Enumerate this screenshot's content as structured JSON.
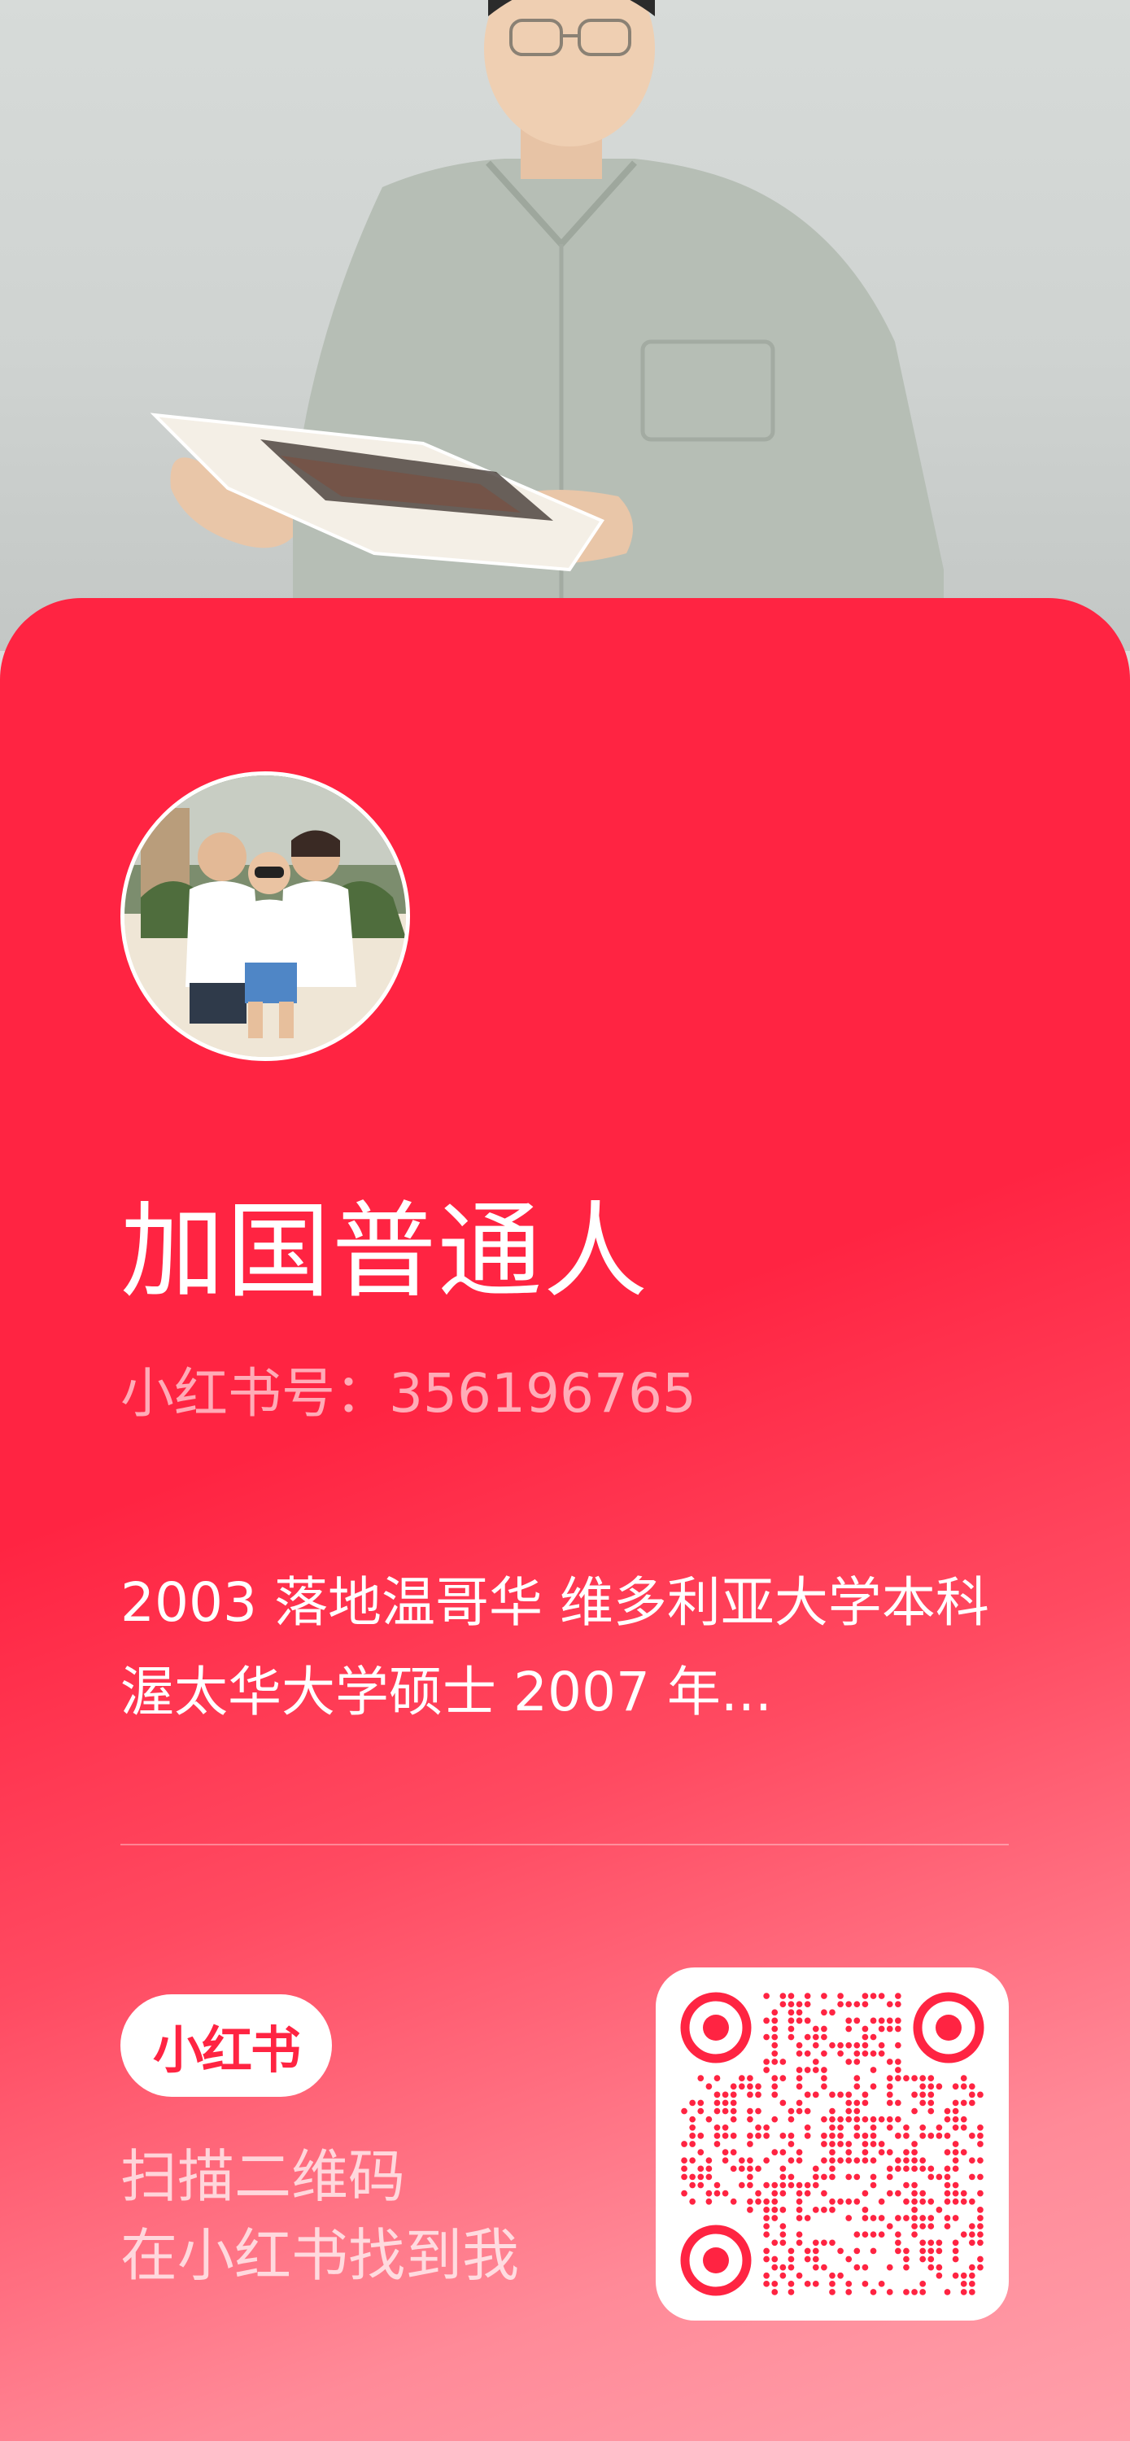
{
  "profile": {
    "nickname": "加国普通人",
    "id_line": "小红书号：356196765",
    "bio": "2003 落地温哥华 维多利亚大学本科 渥太华大学硕士 2007 年..."
  },
  "footer": {
    "brand_label": "小红书",
    "scan_line1": "扫描二维码",
    "scan_line2": "在小红书找到我"
  },
  "colors": {
    "brand_red": "#ff2442",
    "card_gradient_end": "#ffa0ab",
    "qr_background": "#ffffff"
  },
  "icons": {
    "cover": "cover-photo-man-reading",
    "avatar": "avatar-family-photo",
    "qr": "qr-code-icon"
  }
}
